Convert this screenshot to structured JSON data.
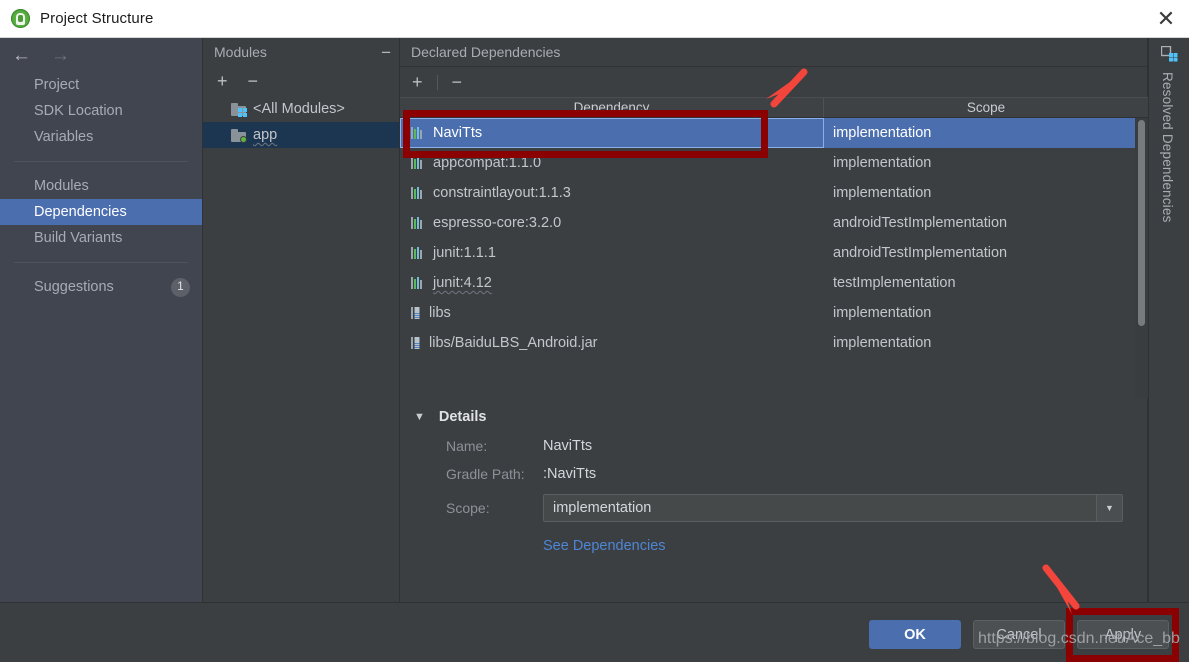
{
  "window": {
    "title": "Project Structure",
    "app_icon": "android-studio-icon",
    "close_label": "✕"
  },
  "sidebar": {
    "back_icon": "←",
    "forward_icon": "→",
    "groups": [
      {
        "items": [
          {
            "label": "Project"
          },
          {
            "label": "SDK Location"
          },
          {
            "label": "Variables"
          }
        ]
      },
      {
        "items": [
          {
            "label": "Modules"
          },
          {
            "label": "Dependencies",
            "selected": true
          },
          {
            "label": "Build Variants"
          }
        ]
      },
      {
        "items": [
          {
            "label": "Suggestions",
            "badge": "1"
          }
        ]
      }
    ]
  },
  "modules_panel": {
    "title": "Modules",
    "collapse_icon": "−",
    "add_label": "+",
    "remove_label": "−",
    "items": [
      {
        "label": "<All Modules>",
        "icon": "folder-all-modules-icon",
        "selected": false
      },
      {
        "label": "app",
        "icon": "folder-module-icon",
        "selected": true,
        "squiggly": true
      }
    ]
  },
  "main_panel": {
    "title": "Declared Dependencies",
    "add_label": "+",
    "remove_label": "−",
    "columns": {
      "dependency": "Dependency",
      "scope": "Scope"
    },
    "rows": [
      {
        "name": "NaviTts",
        "scope": "implementation",
        "icon": "library-icon",
        "selected": true
      },
      {
        "name": "appcompat:1.1.0",
        "scope": "implementation",
        "icon": "library-icon",
        "selected": false
      },
      {
        "name": "constraintlayout:1.1.3",
        "scope": "implementation",
        "icon": "library-icon",
        "selected": false
      },
      {
        "name": "espresso-core:3.2.0",
        "scope": "androidTestImplementation",
        "icon": "library-icon",
        "selected": false
      },
      {
        "name": "junit:1.1.1",
        "scope": "androidTestImplementation",
        "icon": "library-icon",
        "selected": false
      },
      {
        "name": "junit:4.12",
        "scope": "testImplementation",
        "icon": "library-icon",
        "selected": false,
        "squiggly": true
      },
      {
        "name": "libs",
        "scope": "implementation",
        "icon": "jar-icon",
        "selected": false
      },
      {
        "name": "libs/BaiduLBS_Android.jar",
        "scope": "implementation",
        "icon": "jar-icon",
        "selected": false
      }
    ]
  },
  "details": {
    "title": "Details",
    "collapse_icon": "▼",
    "name_label": "Name:",
    "name_value": "NaviTts",
    "gradle_path_label": "Gradle Path:",
    "gradle_path_value": ":NaviTts",
    "scope_label": "Scope:",
    "scope_value": "implementation",
    "scope_dropdown_icon": "▼",
    "see_dependencies_link": "See Dependencies"
  },
  "right_tab": {
    "label": "Resolved Dependencies",
    "icon": "modules-icon"
  },
  "buttons": {
    "ok": "OK",
    "cancel": "Cancel",
    "apply": "Apply"
  },
  "annotations": {
    "watermark": "https://blog.csdn.net/Ace_bb",
    "highlight_color": "#8b0000",
    "arrow_color": "#f4453c"
  },
  "colors": {
    "selection_blue": "#4b6eaf",
    "panel_bg": "#3c3f41",
    "sidebar_bg": "#41454f",
    "link_blue": "#4e86d6",
    "module_selected": "#1c3550"
  }
}
